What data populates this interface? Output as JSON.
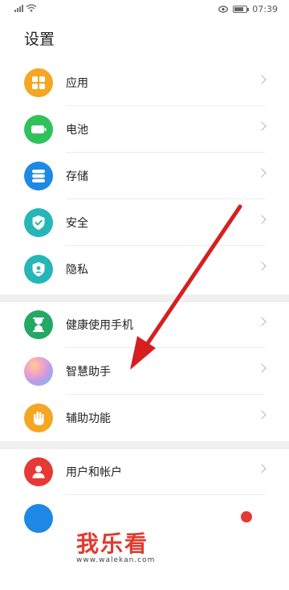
{
  "status": {
    "time": "07:39"
  },
  "page": {
    "title": "设置"
  },
  "groups": [
    {
      "items": [
        {
          "label": "应用",
          "icon": "apps-grid-icon",
          "color": "#f5a623"
        },
        {
          "label": "电池",
          "icon": "battery-icon",
          "color": "#2fc25b"
        },
        {
          "label": "存储",
          "icon": "storage-icon",
          "color": "#1e88e5"
        },
        {
          "label": "安全",
          "icon": "security-shield-icon",
          "color": "#26b6b8"
        },
        {
          "label": "隐私",
          "icon": "privacy-icon",
          "color": "#26b6b8"
        }
      ]
    },
    {
      "items": [
        {
          "label": "健康使用手机",
          "icon": "hourglass-icon",
          "color": "#23a866"
        },
        {
          "label": "智慧助手",
          "icon": "smart-assistant-icon",
          "color": "#b89de8"
        },
        {
          "label": "辅助功能",
          "icon": "hand-icon",
          "color": "#f5a623"
        }
      ]
    },
    {
      "items": [
        {
          "label": "用户和帐户",
          "icon": "user-icon",
          "color": "#e53935"
        }
      ]
    }
  ],
  "watermark": {
    "title": "我乐看",
    "url": "www.walekan.com"
  },
  "colors": {
    "annotation_arrow": "#d61f1f",
    "separator": "#f0f0f0"
  }
}
